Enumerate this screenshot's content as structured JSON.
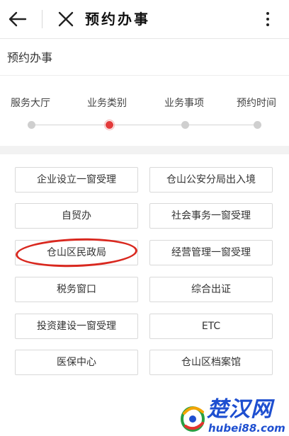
{
  "header": {
    "title": "预约办事"
  },
  "page": {
    "title": "预约办事"
  },
  "steps": [
    {
      "label": "服务大厅",
      "active": false
    },
    {
      "label": "业务类别",
      "active": true
    },
    {
      "label": "业务事项",
      "active": false
    },
    {
      "label": "预约时间",
      "active": false
    }
  ],
  "categories": [
    "企业设立一窗受理",
    "仓山公安分局出入境",
    "自贸办",
    "社会事务一窗受理",
    "仓山区民政局",
    "经营管理一窗受理",
    "税务窗口",
    "综合出证",
    "投资建设一窗受理",
    "ETC",
    "医保中心",
    "仓山区档案馆"
  ],
  "watermark": {
    "brand": "楚汉网",
    "url": "hubei88.com"
  },
  "colors": {
    "accent": "#e33b3b",
    "annotation": "#d9281f",
    "watermark": "#1e4fd0"
  }
}
